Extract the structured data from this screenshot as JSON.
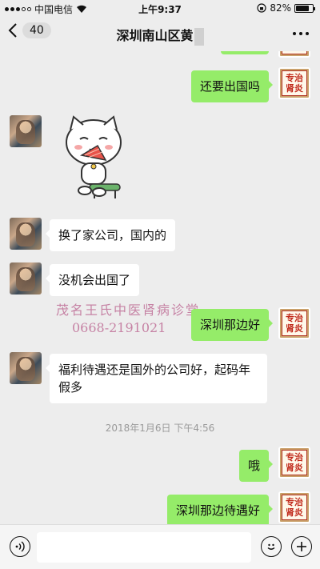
{
  "status_bar": {
    "carrier": "中国电信",
    "time": "上午9:37",
    "battery": "82%",
    "battery_level": 0.82
  },
  "nav": {
    "unread_count": "40",
    "title": "深圳南山区黄"
  },
  "messages": [
    {
      "side": "out",
      "text": "还要出国吗"
    },
    {
      "side": "in",
      "type": "sticker",
      "sticker_name": "cat-fan-sticker"
    },
    {
      "side": "in",
      "text": "换了家公司，国内的"
    },
    {
      "side": "in",
      "text": "没机会出国了"
    },
    {
      "side": "out",
      "text": "深圳那边好"
    },
    {
      "side": "in",
      "text": "福利待遇还是国外的公司好，起码年假多"
    },
    {
      "side": "out",
      "text": "哦"
    },
    {
      "side": "out",
      "text": "深圳那边待遇好"
    }
  ],
  "timestamp": "2018年1月6日 下午4:56",
  "watermark": {
    "line1": "茂名王氏中医肾病诊堂",
    "line2": "0668-2191021"
  },
  "right_avatar": {
    "line1": "专治",
    "line2": "肾炎"
  },
  "input_bar": {
    "voice_icon": "voice-icon",
    "emoji_icon": "emoji-icon",
    "plus_icon": "plus-icon"
  }
}
